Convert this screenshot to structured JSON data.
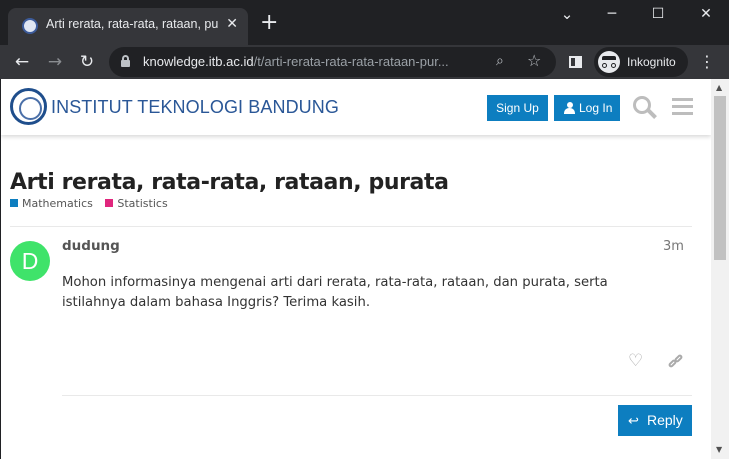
{
  "browser": {
    "tab_title": "Arti rerata, rata-rata, rataan, purata",
    "tab_close": "✕",
    "new_tab": "+",
    "window_controls": {
      "minimize": "─",
      "maximize": "☐",
      "close": "✕",
      "tablist": "⌄"
    },
    "url_host": "knowledge.itb.ac.id",
    "url_path": "/t/arti-rerata-rata-rata-rataan-pur...",
    "profile_label": "Inkognito",
    "icons": [
      "back-arrow-icon",
      "forward-arrow-icon",
      "reload-icon",
      "lock-icon",
      "search-icon",
      "star-icon",
      "side-panel-icon",
      "incognito-icon",
      "kebab-menu-icon"
    ]
  },
  "site": {
    "logo_text": "INSTITUT TEKNOLOGI BANDUNG",
    "signup_label": "Sign Up",
    "login_label": "Log In",
    "accent_color": "#0d7ec0"
  },
  "topic": {
    "title": "Arti rerata, rata-rata, rataan, purata",
    "categories": [
      {
        "name": "Mathematics",
        "color": "#0d7ec0"
      },
      {
        "name": "Statistics",
        "color": "#e0267d"
      }
    ]
  },
  "post": {
    "avatar_letter": "D",
    "avatar_color": "#3fe36a",
    "username": "dudung",
    "age": "3m",
    "body": "Mohon informasinya mengenai arti dari rerata, rata-rata, rataan, dan purata, serta istilahnya dalam bahasa Inggris? Terima kasih."
  },
  "reply_label": "Reply"
}
